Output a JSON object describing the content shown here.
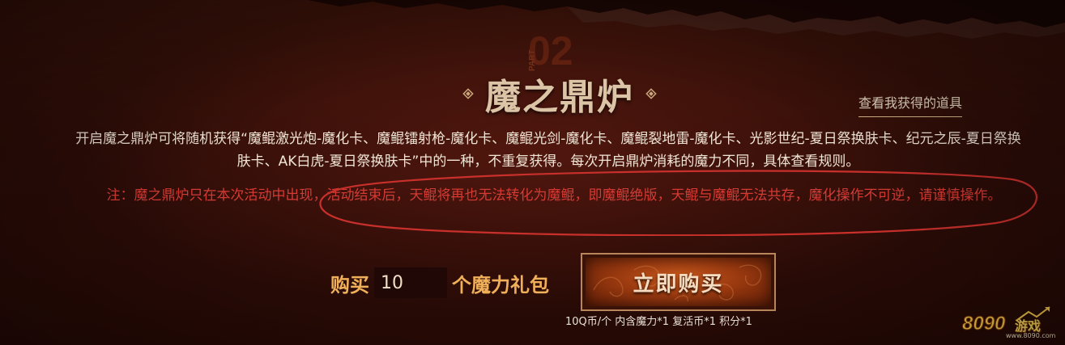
{
  "section": {
    "badge_text": "PART",
    "title": "魔之鼎炉",
    "view_items_link": "查看我获得的道具"
  },
  "description": {
    "main_text": "开启魔之鼎炉可将随机获得“魔鲲激光炮-魔化卡、魔鲲镭射枪-魔化卡、魔鲲光剑-魔化卡、魔鲲裂地雷-魔化卡、光影世纪-夏日祭换肤卡、纪元之辰-夏日祭换肤卡、AK白虎-夏日祭换肤卡”中的一种，不重复获得。每次开启鼎炉消耗的魔力不同，具体查看规则。",
    "note_text": "注：魔之鼎炉只在本次活动中出现，活动结束后，天鲲将再也无法转化为魔鲲，即魔鲲绝版，天鲲与魔鲲无法共存，魔化操作不可逆，请谨慎操作。"
  },
  "purchase": {
    "buy_label": "购买",
    "quantity_value": "10",
    "pack_label": "个魔力礼包",
    "buy_button_label": "立即购买",
    "price_info": "10Q币/个 内含魔力*1 复活币*1 积分*1"
  },
  "watermark": {
    "brand": "游戏",
    "url": "www.8090.com"
  },
  "colors": {
    "background": "#2c0c07",
    "title": "#dcc4a6",
    "note_red": "#d43b34",
    "label_orange": "#f0b05a",
    "button": "#9b3a10"
  },
  "icons": {
    "title_ornament": "diamond-ornament-icon",
    "badge": "part-02-badge-icon",
    "annotation": "red-ellipse-annotation",
    "watermark_logo": "8090-logo-icon"
  }
}
